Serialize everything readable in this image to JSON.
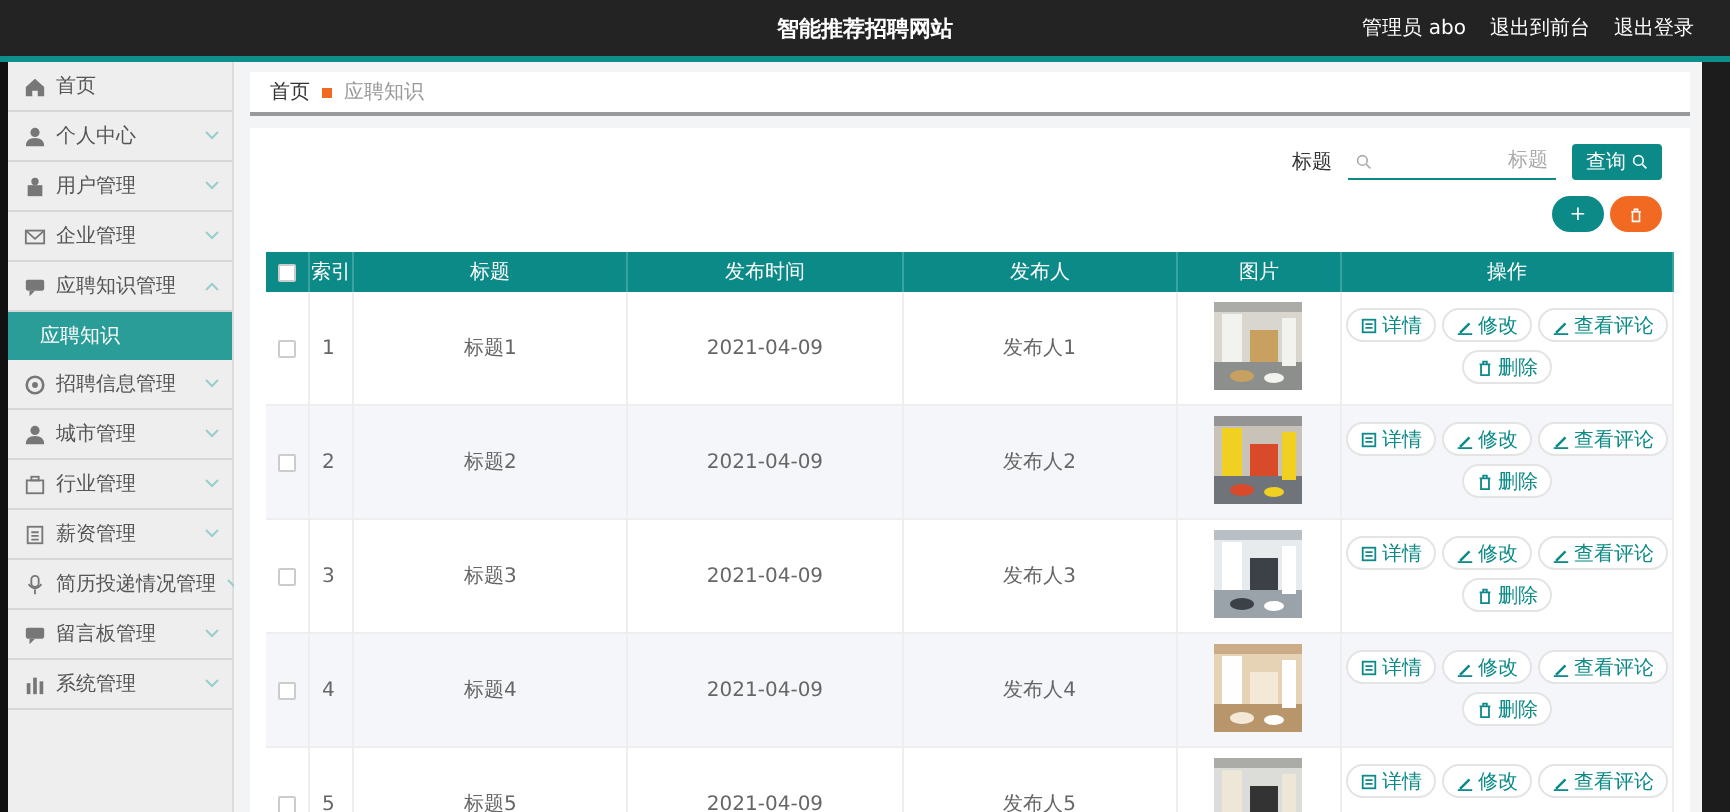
{
  "header": {
    "title": "智能推荐招聘网站",
    "user": "管理员 abo",
    "links": [
      "退出到前台",
      "退出登录"
    ]
  },
  "sidebar": {
    "items": [
      {
        "label": "首页"
      },
      {
        "label": "个人中心",
        "expanded": false
      },
      {
        "label": "用户管理",
        "expanded": false
      },
      {
        "label": "企业管理",
        "expanded": false
      },
      {
        "label": "应聘知识管理",
        "expanded": true,
        "children": [
          {
            "label": "应聘知识",
            "selected": true
          }
        ]
      },
      {
        "label": "招聘信息管理",
        "expanded": false
      },
      {
        "label": "城市管理",
        "expanded": false
      },
      {
        "label": "行业管理",
        "expanded": false
      },
      {
        "label": "薪资管理",
        "expanded": false
      },
      {
        "label": "简历投递情况管理",
        "expanded": false
      },
      {
        "label": "留言板管理",
        "expanded": false
      },
      {
        "label": "系统管理",
        "expanded": false
      }
    ]
  },
  "breadcrumb": [
    "首页",
    "应聘知识"
  ],
  "search": {
    "label": "标题",
    "placeholder": "标题",
    "button": "查询"
  },
  "toolbar": {
    "add": "+"
  },
  "table": {
    "header_checked": false,
    "columns": [
      "索引",
      "标题",
      "发布时间",
      "发布人",
      "图片",
      "操作"
    ],
    "rows": [
      {
        "checked": false,
        "index": "1",
        "title": "标题1",
        "date": "2021-04-09",
        "publisher": "发布人1",
        "actions": [
          {
            "kind": "detail",
            "label": "详情"
          },
          {
            "kind": "edit",
            "label": "修改"
          },
          {
            "kind": "edit",
            "label": "查看评论"
          },
          {
            "kind": "delete",
            "label": "删除"
          }
        ]
      },
      {
        "checked": false,
        "index": "2",
        "title": "标题2",
        "date": "2021-04-09",
        "publisher": "发布人2",
        "actions": [
          {
            "kind": "detail",
            "label": "详情"
          },
          {
            "kind": "edit",
            "label": "修改"
          },
          {
            "kind": "edit",
            "label": "查看评论"
          },
          {
            "kind": "delete",
            "label": "删除"
          }
        ]
      },
      {
        "checked": false,
        "index": "3",
        "title": "标题3",
        "date": "2021-04-09",
        "publisher": "发布人3",
        "actions": [
          {
            "kind": "detail",
            "label": "详情"
          },
          {
            "kind": "edit",
            "label": "修改"
          },
          {
            "kind": "edit",
            "label": "查看评论"
          },
          {
            "kind": "delete",
            "label": "删除"
          }
        ]
      },
      {
        "checked": false,
        "index": "4",
        "title": "标题4",
        "date": "2021-04-09",
        "publisher": "发布人4",
        "actions": [
          {
            "kind": "detail",
            "label": "详情"
          },
          {
            "kind": "edit",
            "label": "修改"
          },
          {
            "kind": "edit",
            "label": "查看评论"
          },
          {
            "kind": "delete",
            "label": "删除"
          }
        ]
      },
      {
        "checked": false,
        "index": "5",
        "title": "标题5",
        "date": "2021-04-09",
        "publisher": "发布人5",
        "actions": [
          {
            "kind": "detail",
            "label": "详情"
          },
          {
            "kind": "edit",
            "label": "修改"
          },
          {
            "kind": "edit",
            "label": "查看评论"
          }
        ]
      }
    ]
  }
}
